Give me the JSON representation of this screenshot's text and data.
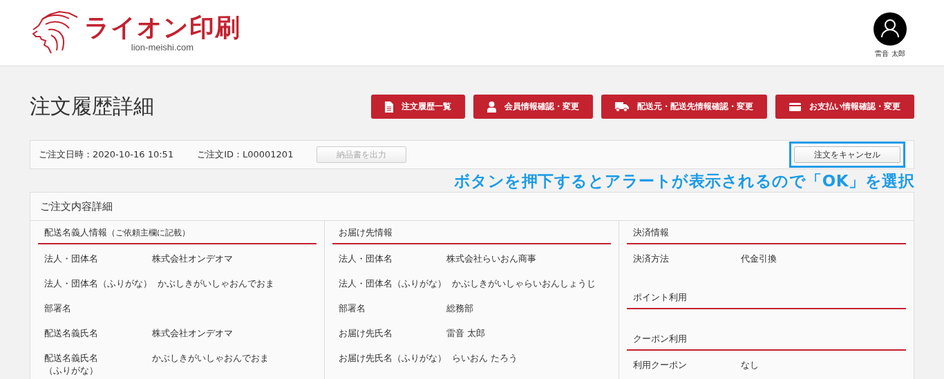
{
  "header": {
    "logo_text": "ライオン印刷",
    "domain": "lion-meishi.com",
    "user_name": "雷音 太郎"
  },
  "page_title": "注文履歴詳細",
  "nav_buttons": [
    {
      "label": "注文履歴一覧",
      "kind": "document"
    },
    {
      "label": "会員情報確認・変更",
      "kind": "person"
    },
    {
      "label": "配送元・配送先情報確認・変更",
      "kind": "truck"
    },
    {
      "label": "お支払い情報確認・変更",
      "kind": "card"
    }
  ],
  "order_bar": {
    "date": "ご注文日時：2020-10-16 10:51",
    "order_id": "ご注文ID：L00001201",
    "invoice_button": {
      "label": "納品書を出力",
      "disabled": true
    },
    "cancel_button": {
      "label": "注文をキャンセル",
      "highlighted": true
    }
  },
  "annotation": "ボタンを押下するとアラートが表示されるので「OK」を選択",
  "details": {
    "title": "ご注文内容詳細",
    "columns": [
      {
        "sections": [
          {
            "heading": "配送名義人情報",
            "note": "（ご依頼主欄に記載）",
            "rows": [
              {
                "label": "法人・団体名",
                "value": "株式会社オンデオマ"
              },
              {
                "label": "法人・団体名（ふりがな）",
                "value": "かぶしきがいしゃおんでおま"
              },
              {
                "label": "部署名"
              },
              {
                "label": "配送名義氏名",
                "value": "株式会社オンデオマ"
              },
              {
                "label": "配送名義氏名（ふりがな）",
                "value": "かぶしきがいしゃおんでおま",
                "kind": "narrow"
              }
            ]
          }
        ]
      },
      {
        "sections": [
          {
            "heading": "お届け先情報",
            "rows": [
              {
                "label": "法人・団体名",
                "value": "株式会社らいおん商事"
              },
              {
                "label": "法人・団体名（ふりがな）",
                "value": "かぶしきがいしゃらいおんしょうじ"
              },
              {
                "label": "部署名",
                "value": "総務部"
              },
              {
                "label": "お届け先氏名",
                "value": "雷音 太郎"
              },
              {
                "label": "お届け先氏名（ふりがな）",
                "value": "らいおん たろう"
              }
            ]
          }
        ]
      },
      {
        "sections": [
          {
            "heading": "決済情報",
            "rows": [
              {
                "label": "決済方法",
                "value": "代金引換"
              }
            ]
          },
          {
            "heading": "ポイント利用"
          },
          {
            "heading": "クーポン利用",
            "rows": [
              {
                "label": "利用クーポン",
                "value": "なし"
              }
            ]
          }
        ]
      }
    ]
  }
}
